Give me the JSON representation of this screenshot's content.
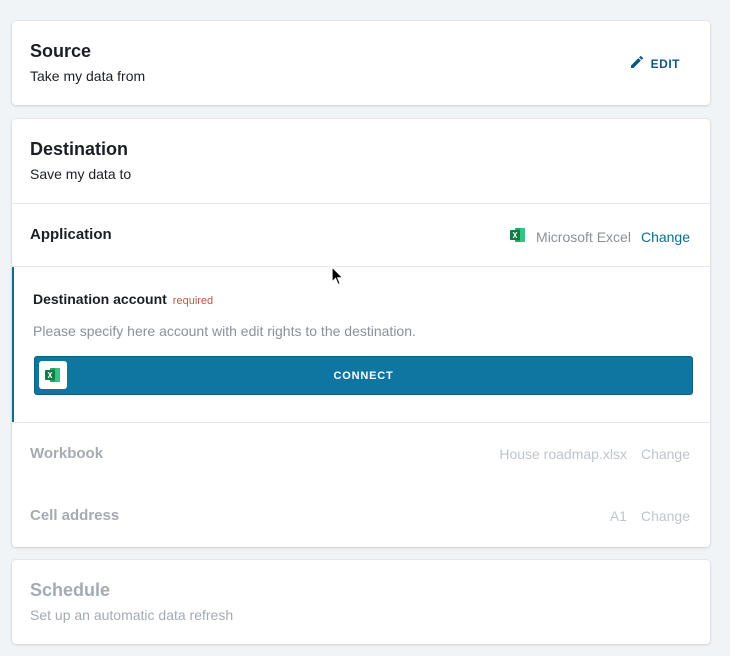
{
  "source": {
    "title": "Source",
    "subtitle": "Take my data from",
    "edit_label": "EDIT",
    "edit_icon": "pencil-icon"
  },
  "destination": {
    "title": "Destination",
    "subtitle": "Save my data to",
    "application": {
      "label": "Application",
      "value": "Microsoft Excel",
      "icon": "excel-icon",
      "change_label": "Change"
    },
    "account": {
      "label": "Destination account",
      "required_label": "required",
      "help_text": "Please specify here account with edit rights to the destination.",
      "connect_label": "CONNECT"
    },
    "workbook": {
      "label": "Workbook",
      "value": "House roadmap.xlsx",
      "change_label": "Change"
    },
    "cell_address": {
      "label": "Cell address",
      "value": "A1",
      "change_label": "Change"
    }
  },
  "schedule": {
    "title": "Schedule",
    "subtitle": "Set up an automatic data refresh"
  },
  "colors": {
    "accent": "#0e76a0",
    "link": "#0e6e8f",
    "required": "#c0554a",
    "excel_green": "#1e7145"
  }
}
